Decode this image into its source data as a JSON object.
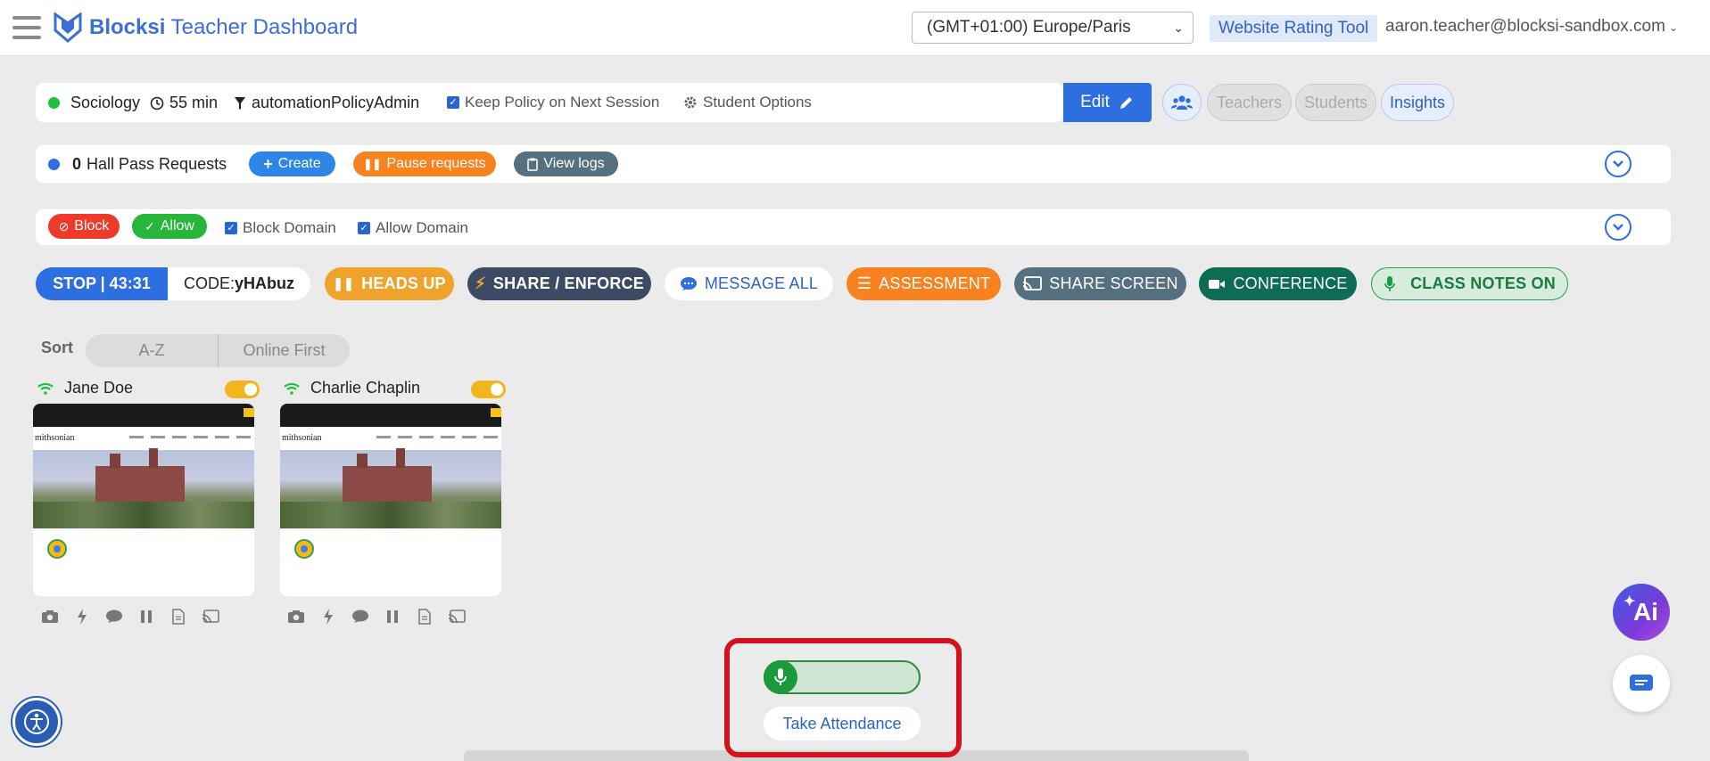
{
  "header": {
    "logo_bold": "Blocksi",
    "logo_rest": " Teacher Dashboard",
    "timezone": "(GMT+01:00) Europe/Paris",
    "rating_tool": "Website Rating Tool",
    "user_email": "aaron.teacher@blocksi-sandbox.com"
  },
  "session": {
    "class_name": "Sociology",
    "duration": "55 min",
    "policy": "automationPolicyAdmin",
    "keep_policy_label": "Keep Policy on Next Session",
    "keep_policy_checked": true,
    "student_options": "Student Options",
    "edit_label": "Edit",
    "teachers_label": "Teachers",
    "students_label": "Students",
    "insights_label": "Insights"
  },
  "hall_pass": {
    "count": "0",
    "label": "Hall Pass Requests",
    "create_label": "Create",
    "pause_label": "Pause requests",
    "logs_label": "View logs"
  },
  "domains": {
    "block_label": "Block",
    "allow_label": "Allow",
    "block_domain_label": "Block Domain",
    "allow_domain_label": "Allow Domain"
  },
  "actions": {
    "stop_label": "STOP | 43:31",
    "code_prefix": "CODE: ",
    "code_value": "yHAbuz",
    "heads_up": "HEADS UP",
    "share_enforce": "SHARE / ENFORCE",
    "message_all": "MESSAGE ALL",
    "assessment": "ASSESSMENT",
    "share_screen": "SHARE SCREEN",
    "conference": "CONFERENCE",
    "class_notes": "CLASS NOTES ON"
  },
  "sort": {
    "label": "Sort",
    "options": [
      "A-Z",
      "Online First"
    ]
  },
  "students": [
    {
      "name": "Jane Doe",
      "site": "mithsonian"
    },
    {
      "name": "Charlie Chaplin",
      "site": "mithsonian"
    }
  ],
  "attendance": {
    "button_label": "Take Attendance"
  },
  "floating": {
    "ai_label": "Ai"
  },
  "colors": {
    "primary": "#2d6ee0",
    "heads_up": "#f0a32c",
    "share_enforce": "#3c4a63",
    "assessment": "#f7821f",
    "share_screen": "#55707f",
    "conference": "#0e6b55",
    "online": "#1fbf3c"
  }
}
